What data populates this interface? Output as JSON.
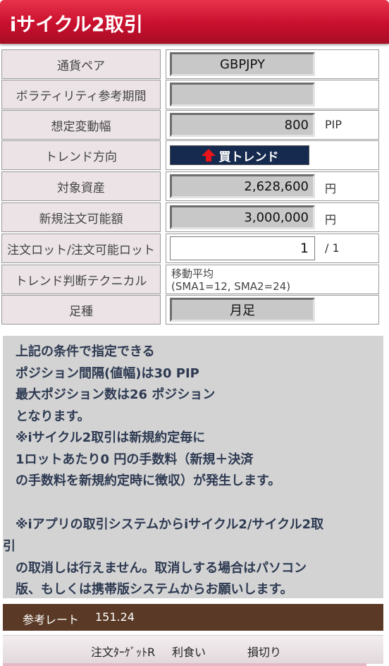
{
  "header": {
    "title": "iサイクル2取引"
  },
  "form": {
    "pair": {
      "label": "通貨ペア",
      "value": "GBPJPY"
    },
    "volatility": {
      "label": "ボラティリティ参考期間",
      "value": ""
    },
    "range": {
      "label": "想定変動幅",
      "value": "800",
      "unit": "PIP"
    },
    "trend": {
      "label": "トレンド方向",
      "button_label": "買トレンド"
    },
    "asset": {
      "label": "対象資産",
      "value": "2,628,600",
      "unit": "円"
    },
    "available": {
      "label": "新規注文可能額",
      "value": "3,000,000",
      "unit": "円"
    },
    "lot": {
      "label": "注文ロット/注文可能ロット",
      "value": "1",
      "max": "/ 1"
    },
    "technical": {
      "label": "トレンド判断テクニカル",
      "line1": "移動平均",
      "line2": "(SMA1=12, SMA2=24)"
    },
    "timeframe": {
      "label": "足種",
      "value": "月足"
    }
  },
  "notice": {
    "lines": [
      "上記の条件で指定できる",
      "ポジション間隔(値幅)は30 PIP",
      "最大ポジション数は26 ポジション",
      "となります。",
      "※iサイクル2取引は新規約定毎に",
      "1ロットあたり0 円の手数料（新規＋決済",
      "の手数料を新規約定時に徴収）が発生します。",
      "※iアプリの取引システムからiサイクル2/サイクル2取",
      "引",
      "の取消しは行えません。取消しする場合はパソコン",
      "版、もしくは携帯版システムからお願いします。"
    ]
  },
  "rate": {
    "label": "参考レート",
    "value": "151.24"
  },
  "tabs": {
    "target": "注文ﾀｰｹﾞｯﾄR",
    "profit": "利食い",
    "stop": "損切り"
  },
  "colors": {
    "header": "#c8102e",
    "rate_bar": "#5a3a26",
    "trend_button": "#152a4e",
    "trend_arrow": "#e8141c"
  }
}
